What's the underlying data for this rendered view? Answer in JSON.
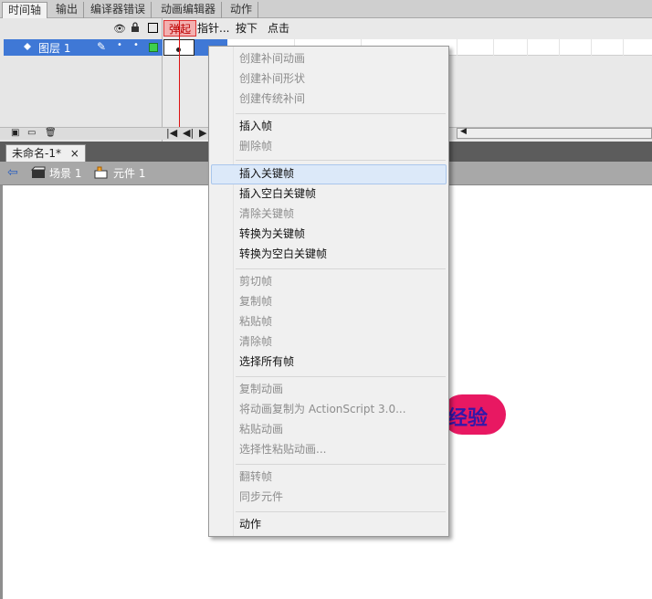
{
  "panel_tabs": [
    "时间轴",
    "输出",
    "编译器错误",
    "动画编辑器",
    "动作"
  ],
  "timeline": {
    "frame_labels": [
      "弹起",
      "指针...",
      "按下",
      "点击"
    ],
    "layer_name": "图层 1",
    "col_icons": [
      "eye-icon",
      "lock-icon",
      "outline-icon"
    ]
  },
  "document": {
    "tab_title": "未命名-1*",
    "close_glyph": "×",
    "breadcrumbs": [
      "场景 1",
      "元件 1"
    ]
  },
  "stage": {
    "shape_text": "经验",
    "shape_color": "#e81862",
    "text_color": "#3418a8"
  },
  "context_menu": {
    "groups": [
      [
        {
          "label": "创建补间动画",
          "enabled": false
        },
        {
          "label": "创建补间形状",
          "enabled": false
        },
        {
          "label": "创建传统补间",
          "enabled": false
        }
      ],
      [
        {
          "label": "插入帧",
          "enabled": true
        },
        {
          "label": "删除帧",
          "enabled": false
        }
      ],
      [
        {
          "label": "插入关键帧",
          "enabled": true,
          "highlighted": true
        },
        {
          "label": "插入空白关键帧",
          "enabled": true
        },
        {
          "label": "清除关键帧",
          "enabled": false
        },
        {
          "label": "转换为关键帧",
          "enabled": true
        },
        {
          "label": "转换为空白关键帧",
          "enabled": true
        }
      ],
      [
        {
          "label": "剪切帧",
          "enabled": false
        },
        {
          "label": "复制帧",
          "enabled": false
        },
        {
          "label": "粘贴帧",
          "enabled": false
        },
        {
          "label": "清除帧",
          "enabled": false
        },
        {
          "label": "选择所有帧",
          "enabled": true
        }
      ],
      [
        {
          "label": "复制动画",
          "enabled": false
        },
        {
          "label": "将动画复制为 ActionScript 3.0...",
          "enabled": false
        },
        {
          "label": "粘贴动画",
          "enabled": false
        },
        {
          "label": "选择性粘贴动画...",
          "enabled": false
        }
      ],
      [
        {
          "label": "翻转帧",
          "enabled": false
        },
        {
          "label": "同步元件",
          "enabled": false
        }
      ],
      [
        {
          "label": "动作",
          "enabled": true
        }
      ]
    ]
  },
  "colors": {
    "selection_blue": "#3f78d6",
    "playhead_red": "#d11111",
    "menu_highlight": "#dce9f9"
  }
}
